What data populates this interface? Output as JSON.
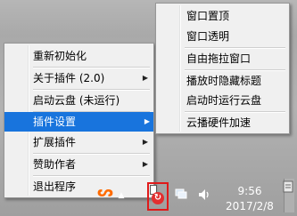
{
  "main_menu": {
    "items": [
      {
        "label": "重新初始化",
        "has_submenu": false
      },
      {
        "label": "关于插件 (2.0)",
        "has_submenu": true
      },
      {
        "label": "启动云盘 (未运行)",
        "has_submenu": false
      },
      {
        "label": "插件设置",
        "has_submenu": true,
        "highlighted": true
      },
      {
        "label": "扩展插件",
        "has_submenu": true
      },
      {
        "label": "赞助作者",
        "has_submenu": true
      },
      {
        "label": "退出程序",
        "has_submenu": false
      }
    ]
  },
  "submenu": {
    "items": [
      {
        "label": "窗口置顶"
      },
      {
        "label": "窗口透明"
      },
      {
        "label": "自由拖拉窗口"
      },
      {
        "label": "播放时隐藏标题"
      },
      {
        "label": "启动时运行云盘"
      },
      {
        "label": "云播硬件加速"
      }
    ]
  },
  "taskbar": {
    "clock_time": "9:56",
    "clock_date": "2017/2/8"
  },
  "colors": {
    "highlight": "#1874dd",
    "annotation_box": "#e01a1a"
  }
}
